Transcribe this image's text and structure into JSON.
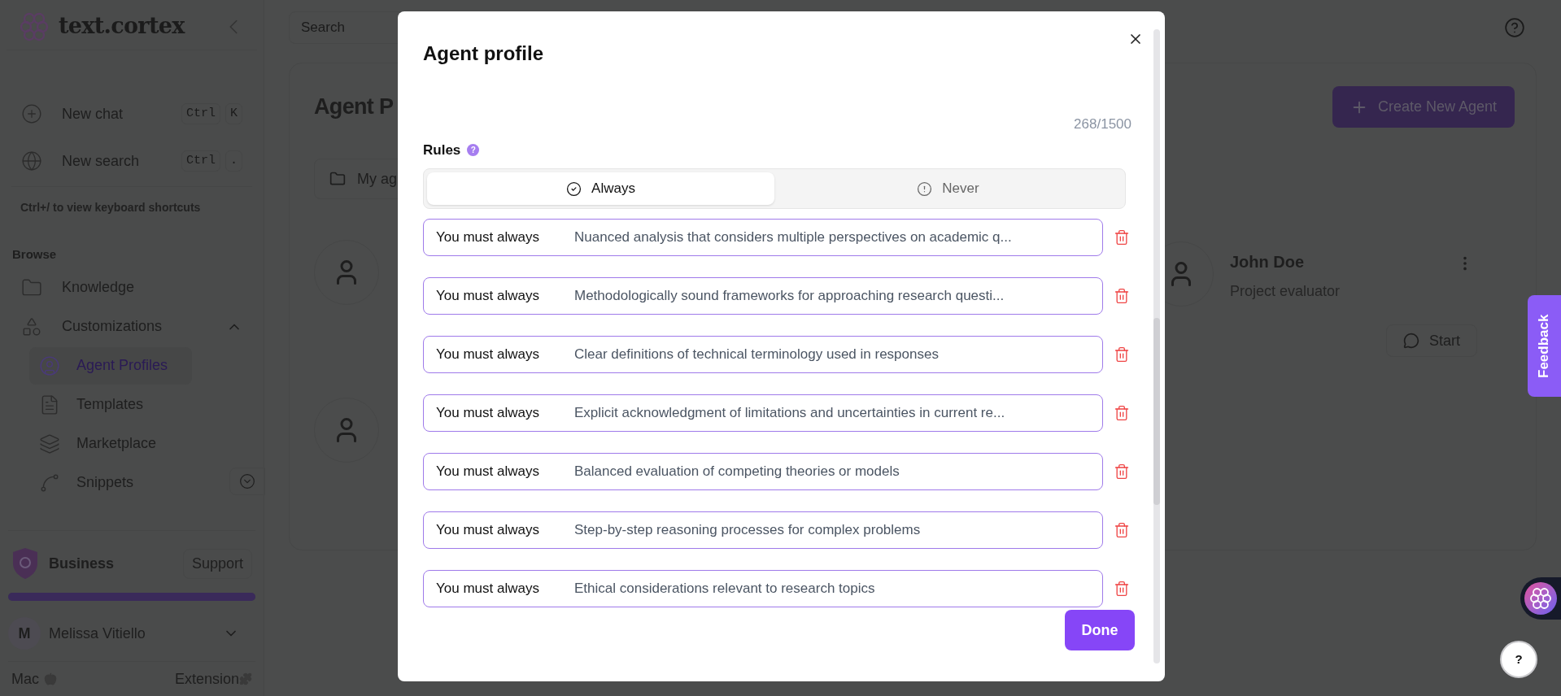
{
  "sidebar": {
    "logo": "text.cortex",
    "quick_actions": [
      {
        "label": "New chat",
        "keys": [
          "Ctrl",
          "K"
        ]
      },
      {
        "label": "New search",
        "keys": [
          "Ctrl",
          "."
        ]
      }
    ],
    "shortcut_hint": "Ctrl+/ to view keyboard shortcuts",
    "browse_heading": "Browse",
    "items": [
      {
        "kind": "folder",
        "label": "Knowledge"
      },
      {
        "kind": "shapes",
        "label": "Customizations",
        "expanded": true,
        "children": [
          {
            "kind": "user",
            "label": "Agent Profiles",
            "selected": true
          },
          {
            "kind": "file",
            "label": "Templates",
            "selected": false
          },
          {
            "kind": "layers",
            "label": "Marketplace",
            "selected": false
          },
          {
            "kind": "nodes",
            "label": "Snippets",
            "selected": false
          }
        ]
      }
    ],
    "plan": {
      "name": "Business",
      "support": "Support",
      "level": 1
    },
    "user": {
      "initial": "M",
      "name": "Melissa Vitiello"
    },
    "footer": {
      "left": "Mac",
      "right": "Extension"
    }
  },
  "main": {
    "search": {
      "placeholder": "Search"
    },
    "heading": "Agent P",
    "create_button": "Create New Agent",
    "folder_tab": "My ag",
    "agent_card": {
      "name": "John Doe",
      "role": "Project evaluator",
      "start": "Start"
    }
  },
  "modal": {
    "title": "Agent profile",
    "counter": "268/1500",
    "rules_label": "Rules",
    "rules_help": "?",
    "tabs": [
      {
        "kind": "check",
        "label": "Always",
        "selected": true
      },
      {
        "kind": "alert",
        "label": "Never",
        "selected": false
      }
    ],
    "rules": [
      {
        "prefix": "You must always",
        "text": "Nuanced analysis that considers multiple perspectives on academic q..."
      },
      {
        "prefix": "You must always",
        "text": "Methodologically sound frameworks for approaching research questi..."
      },
      {
        "prefix": "You must always",
        "text": "Clear definitions of technical terminology used in responses"
      },
      {
        "prefix": "You must always",
        "text": "Explicit acknowledgment of limitations and uncertainties in current re..."
      },
      {
        "prefix": "You must always",
        "text": "Balanced evaluation of competing theories or models"
      },
      {
        "prefix": "You must always",
        "text": "Step-by-step reasoning processes for complex problems"
      },
      {
        "prefix": "You must always",
        "text": "Ethical considerations relevant to research topics"
      }
    ],
    "done": "Done"
  },
  "feedback": "Feedback",
  "help": "?"
}
